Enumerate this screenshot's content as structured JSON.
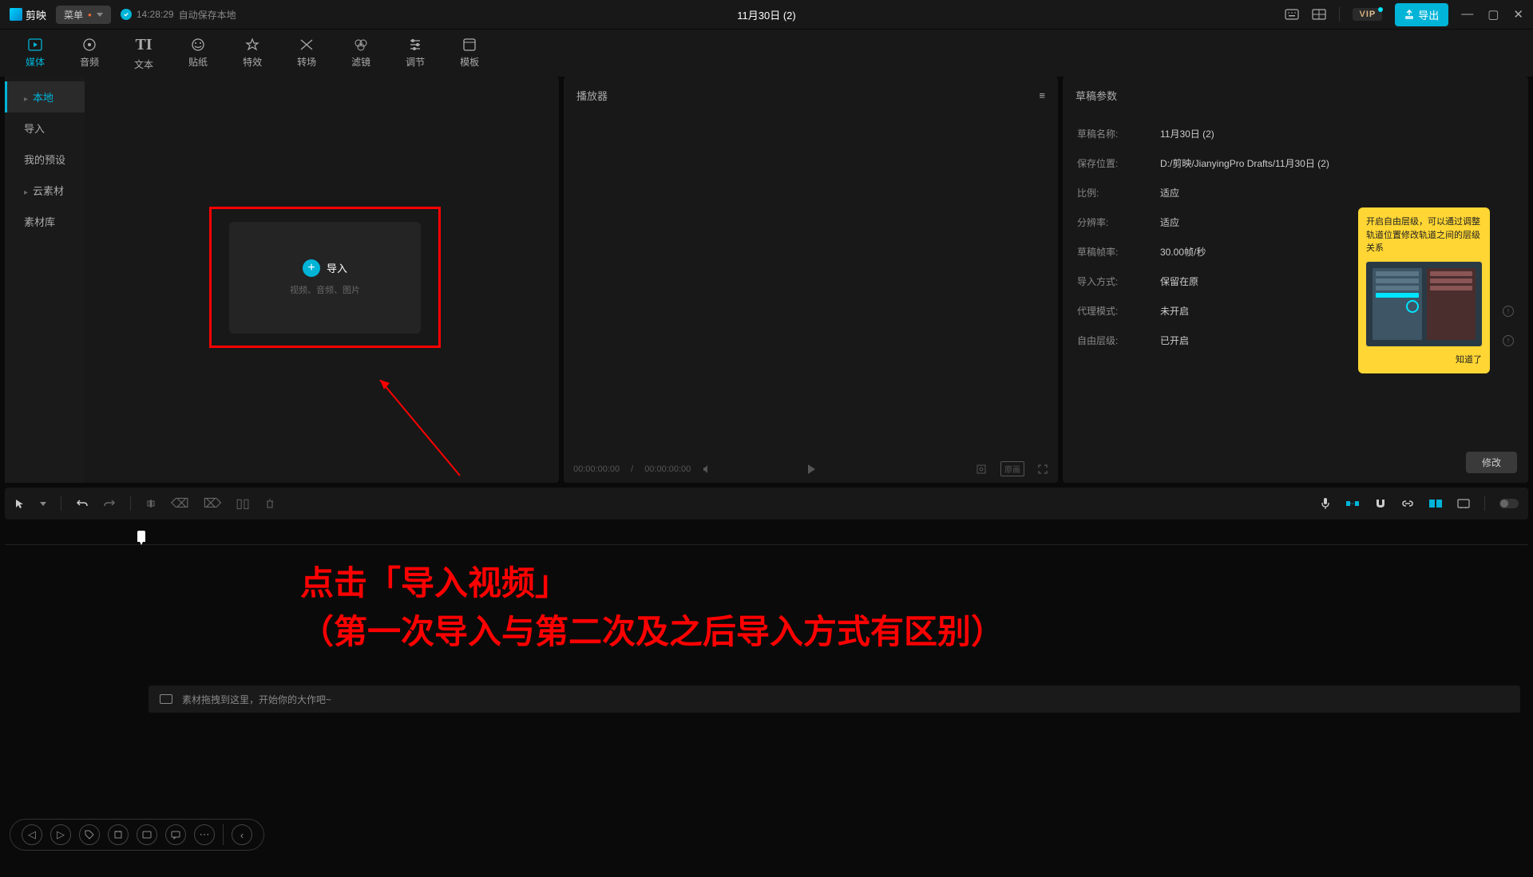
{
  "titlebar": {
    "app_name": "剪映",
    "menu_label": "菜单",
    "autosave_time": "14:28:29",
    "autosave_text": "自动保存本地",
    "project_title": "11月30日 (2)",
    "vip_label": "VIP",
    "export_label": "导出"
  },
  "top_tabs": [
    {
      "icon": "media",
      "label": "媒体"
    },
    {
      "icon": "audio",
      "label": "音频"
    },
    {
      "icon": "text",
      "label": "文本"
    },
    {
      "icon": "sticker",
      "label": "贴纸"
    },
    {
      "icon": "effect",
      "label": "特效"
    },
    {
      "icon": "transition",
      "label": "转场"
    },
    {
      "icon": "filter",
      "label": "滤镜"
    },
    {
      "icon": "adjust",
      "label": "调节"
    },
    {
      "icon": "template",
      "label": "模板"
    }
  ],
  "sidebar": {
    "items": [
      "本地",
      "导入",
      "我的预设",
      "云素材",
      "素材库"
    ]
  },
  "import_box": {
    "title": "导入",
    "subtitle": "视频、音频、图片"
  },
  "player": {
    "title": "播放器",
    "time_current": "00:00:00:00",
    "time_total": "00:00:00:00",
    "quality": "原画"
  },
  "params": {
    "title": "草稿参数",
    "rows": [
      {
        "label": "草稿名称:",
        "value": "11月30日 (2)"
      },
      {
        "label": "保存位置:",
        "value": "D:/剪映/JianyingPro Drafts/11月30日 (2)"
      },
      {
        "label": "比例:",
        "value": "适应"
      },
      {
        "label": "分辨率:",
        "value": "适应"
      },
      {
        "label": "草稿帧率:",
        "value": "30.00帧/秒"
      },
      {
        "label": "导入方式:",
        "value": "保留在原"
      },
      {
        "label": "代理模式:",
        "value": "未开启"
      },
      {
        "label": "自由层级:",
        "value": "已开启"
      }
    ],
    "modify_btn": "修改"
  },
  "tooltip": {
    "text": "开启自由层级，可以通过调整轨道位置修改轨道之间的层级关系",
    "ok": "知道了"
  },
  "timeline": {
    "empty_hint": "素材拖拽到这里，开始你的大作吧~"
  },
  "annotation": {
    "line1": "点击「导入视频」",
    "line2": "（第一次导入与第二次及之后导入方式有区别）"
  }
}
